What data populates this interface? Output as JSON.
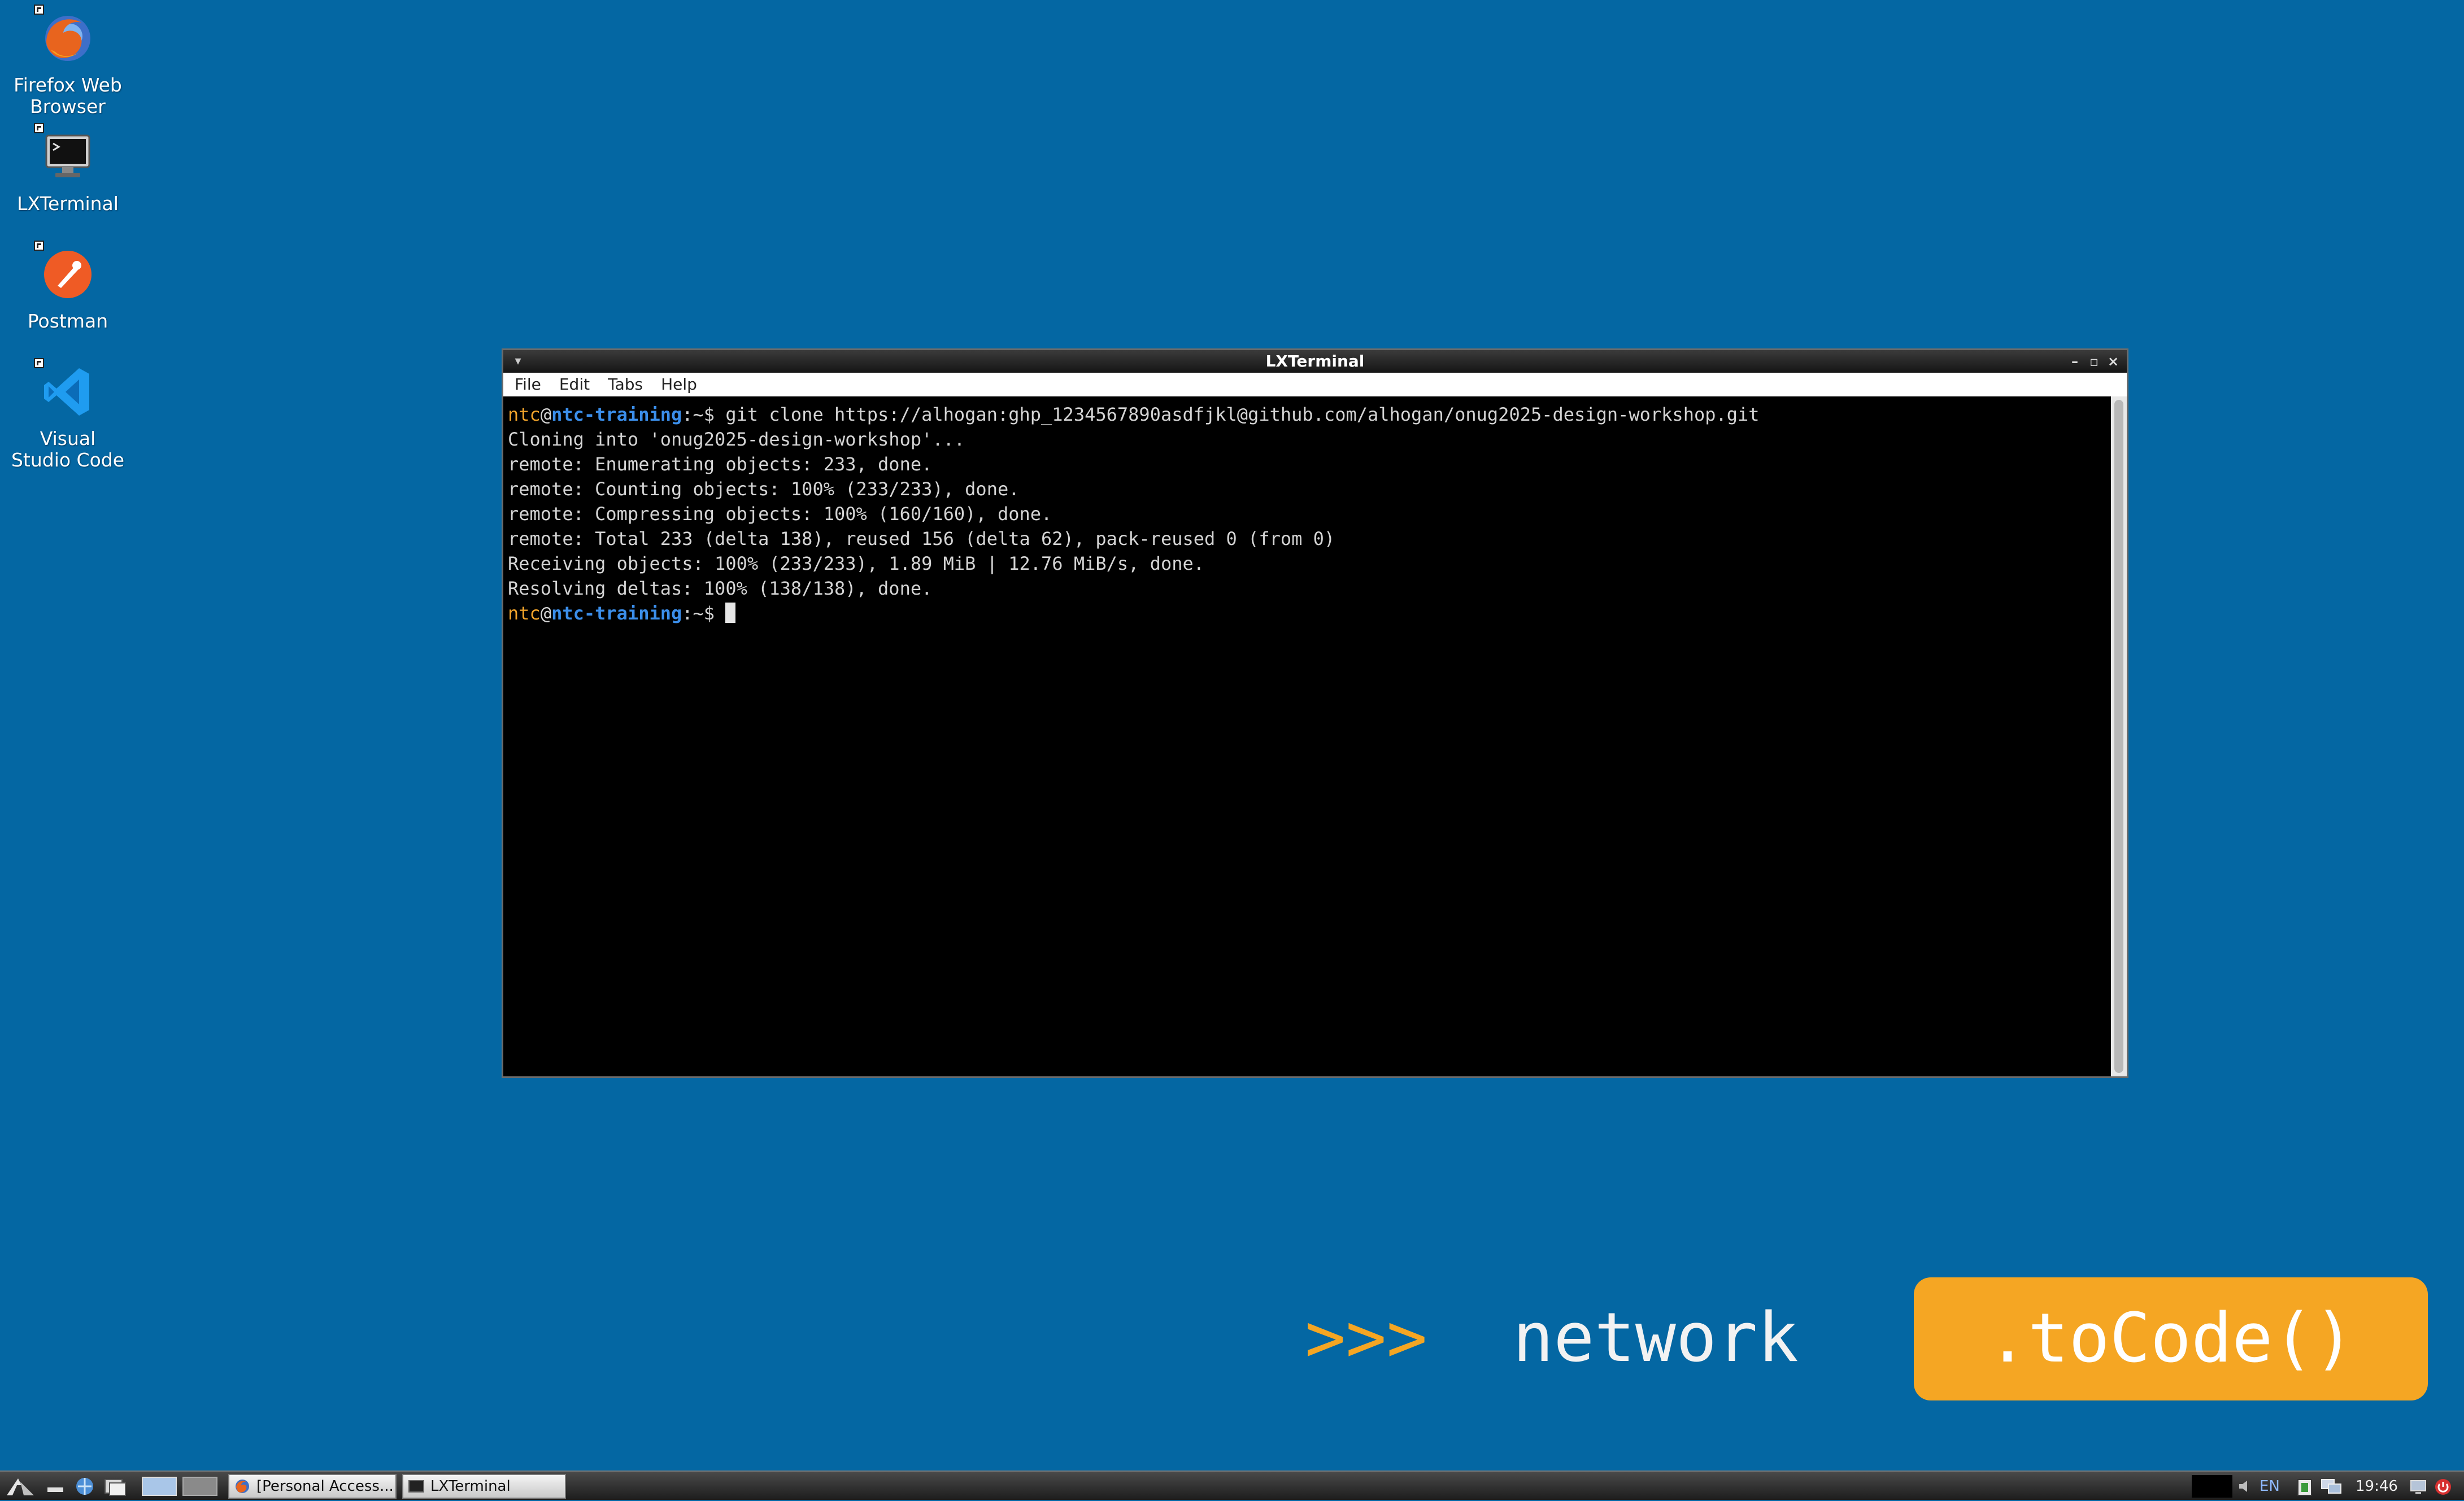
{
  "desktop_icons": [
    {
      "label": "Firefox Web\nBrowser",
      "icon": "firefox-icon"
    },
    {
      "label": "LXTerminal",
      "icon": "terminal-icon"
    },
    {
      "label": "Postman",
      "icon": "postman-icon"
    },
    {
      "label": "Visual\nStudio Code",
      "icon": "vscode-icon"
    }
  ],
  "window": {
    "title": "LXTerminal",
    "menu": [
      "File",
      "Edit",
      "Tabs",
      "Help"
    ],
    "terminal": {
      "prompt_user": "ntc",
      "prompt_at": "@",
      "prompt_host": "ntc-training",
      "prompt_suffix": ":~$ ",
      "command": "git clone https://alhogan:ghp_1234567890asdfjkl@github.com/alhogan/onug2025-design-workshop.git",
      "output": [
        "Cloning into 'onug2025-design-workshop'...",
        "remote: Enumerating objects: 233, done.",
        "remote: Counting objects: 100% (233/233), done.",
        "remote: Compressing objects: 100% (160/160), done.",
        "remote: Total 233 (delta 138), reused 156 (delta 62), pack-reused 0 (from 0)",
        "Receiving objects: 100% (233/233), 1.89 MiB | 12.76 MiB/s, done.",
        "Resolving deltas: 100% (138/138), done."
      ]
    }
  },
  "branding": {
    "prompt": ">>>",
    "word": "network",
    "pill": ".toCode()"
  },
  "taskbar": {
    "tasks": [
      {
        "label": "[Personal Access...",
        "icon": "firefox-icon"
      },
      {
        "label": "LXTerminal",
        "icon": "terminal-icon"
      }
    ],
    "keyboard_layout": "EN",
    "clock": "19:46"
  },
  "colors": {
    "desktop": "#0467a3",
    "accent_orange": "#f5a623",
    "prompt_host": "#3b8eea"
  }
}
